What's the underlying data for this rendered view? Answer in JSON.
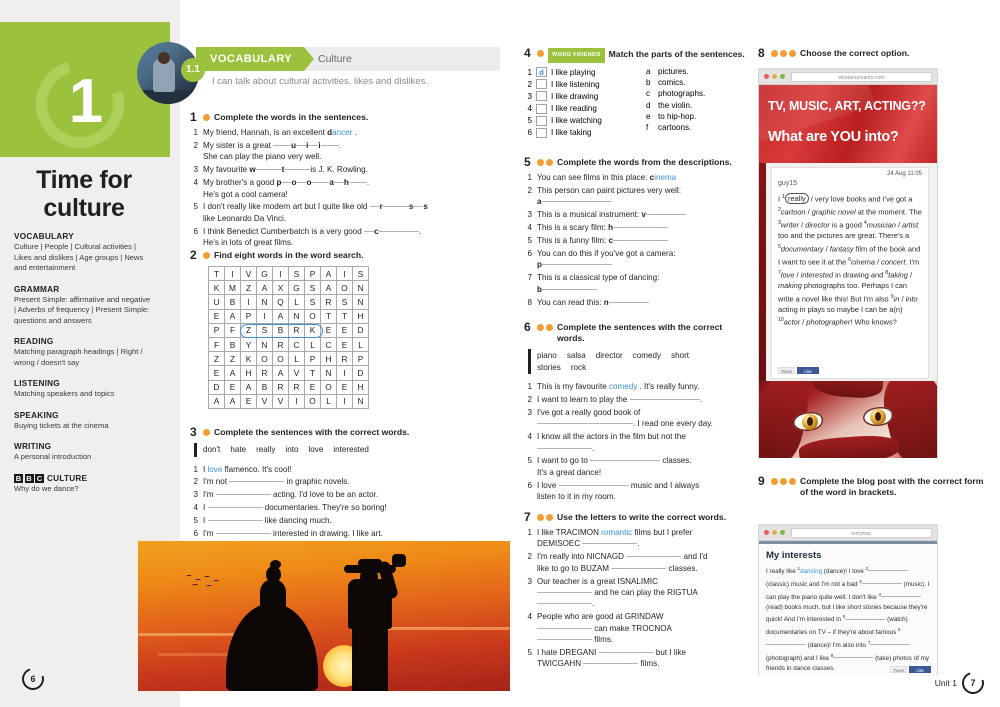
{
  "unit": {
    "number": "1",
    "title": "Time for\nculture",
    "lesson_badge": "1.1"
  },
  "header": {
    "section_label": "VOCABULARY",
    "topic": "Culture",
    "can_do": "I can talk about cultural activities, likes and dislikes."
  },
  "syllabus": [
    {
      "title": "VOCABULARY",
      "body": "Culture | People | Cultural activities | Likes and dislikes | Age groups | News and entertainment"
    },
    {
      "title": "GRAMMAR",
      "body": "Present Simple: affirmative and negative | Adverbs of frequency | Present Simple: questions and answers"
    },
    {
      "title": "READING",
      "body": "Matching paragraph headings | Right / wrong / doesn't say"
    },
    {
      "title": "LISTENING",
      "body": "Matching speakers and topics"
    },
    {
      "title": "SPEAKING",
      "body": "Buying tickets at the cinema"
    },
    {
      "title": "WRITING",
      "body": "A personal introduction"
    }
  ],
  "bbc": {
    "letters": "BBC",
    "word": "CULTURE",
    "body": "Why do we dance?"
  },
  "ex1": {
    "number": "1",
    "dots": 1,
    "title": "Complete the words in the sentences.",
    "items": [
      {
        "n": "1",
        "pre": "My friend, Hannah, is an excellent ",
        "bold": "d",
        "answer": "ancer",
        "post": "."
      },
      {
        "n": "2",
        "pre": "My sister is a great ",
        "bold": "",
        "answer": "",
        "post": " u i i . She can play the piano very well."
      },
      {
        "n": "3",
        "pre": "My favourite ",
        "bold": "w",
        "answer": "",
        "post": " t is J. K. Rowling."
      },
      {
        "n": "4",
        "pre": "My brother's a good ",
        "bold": "p",
        "answer": "",
        "post": " o o a h . He's got a cool camera!"
      },
      {
        "n": "5",
        "pre": "I don't really like modern art but I quite like old ",
        "bold": "",
        "answer": "",
        "post": " r s s like Leonardo Da Vinci."
      },
      {
        "n": "6",
        "pre": "I think Benedict Cumberbatch is a very good ",
        "bold": "",
        "answer": "",
        "post": " c . He's in lots of great films."
      }
    ]
  },
  "ex2": {
    "number": "2",
    "dots": 1,
    "title": "Find eight words in the word search.",
    "grid": [
      [
        "T",
        "I",
        "V",
        "G",
        "I",
        "S",
        "P",
        "A",
        "I",
        "S"
      ],
      [
        "K",
        "M",
        "Z",
        "A",
        "X",
        "G",
        "S",
        "A",
        "O",
        "N"
      ],
      [
        "U",
        "B",
        "I",
        "N",
        "Q",
        "L",
        "S",
        "R",
        "S",
        "N"
      ],
      [
        "E",
        "A",
        "P",
        "I",
        "A",
        "N",
        "O",
        "T",
        "T",
        "H"
      ],
      [
        "P",
        "F",
        "Z",
        "S",
        "B",
        "R",
        "K",
        "E",
        "E",
        "D"
      ],
      [
        "F",
        "B",
        "Y",
        "N",
        "R",
        "C",
        "L",
        "C",
        "E",
        "L"
      ],
      [
        "Z",
        "Z",
        "K",
        "O",
        "O",
        "L",
        "P",
        "H",
        "R",
        "P"
      ],
      [
        "E",
        "A",
        "H",
        "R",
        "A",
        "V",
        "T",
        "N",
        "I",
        "D"
      ],
      [
        "D",
        "E",
        "A",
        "B",
        "R",
        "R",
        "E",
        "O",
        "E",
        "H"
      ],
      [
        "A",
        "A",
        "E",
        "V",
        "V",
        "I",
        "O",
        "L",
        "I",
        "N"
      ]
    ],
    "highlighted_word": "PIANO"
  },
  "ex3": {
    "number": "3",
    "dots": 1,
    "title": "Complete the sentences with the correct words.",
    "wordbank": [
      "don't",
      "hate",
      "really",
      "into",
      "love",
      "interested"
    ],
    "items": [
      {
        "n": "1",
        "pre": "I ",
        "answer": "love",
        "post": " flamenco. It's cool!"
      },
      {
        "n": "2",
        "pre": "I'm not ",
        "answer": "",
        "post": " in graphic novels."
      },
      {
        "n": "3",
        "pre": "I'm ",
        "answer": "",
        "post": " acting. I'd love to be an actor."
      },
      {
        "n": "4",
        "pre": "I ",
        "answer": "",
        "post": " documentaries. They're so boring!"
      },
      {
        "n": "5",
        "pre": "I ",
        "answer": "",
        "post": " like dancing much."
      },
      {
        "n": "6",
        "pre": "I'm ",
        "answer": "",
        "post": " interested in drawing. I like art."
      }
    ]
  },
  "ex4": {
    "number": "4",
    "dots": 1,
    "tag": "WORD FRIENDS",
    "title": "Match the parts of the sentences.",
    "left": [
      {
        "n": "1",
        "box": "d",
        "text": "I like playing"
      },
      {
        "n": "2",
        "box": "",
        "text": "I like listening"
      },
      {
        "n": "3",
        "box": "",
        "text": "I like drawing"
      },
      {
        "n": "4",
        "box": "",
        "text": "I like reading"
      },
      {
        "n": "5",
        "box": "",
        "text": "I like watching"
      },
      {
        "n": "6",
        "box": "",
        "text": "I like taking"
      }
    ],
    "right": [
      {
        "l": "a",
        "text": "pictures."
      },
      {
        "l": "b",
        "text": "comics."
      },
      {
        "l": "c",
        "text": "photographs."
      },
      {
        "l": "d",
        "text": "the violin."
      },
      {
        "l": "e",
        "text": "to hip-hop."
      },
      {
        "l": "f",
        "text": "cartoons."
      }
    ]
  },
  "ex5": {
    "number": "5",
    "dots": 2,
    "title": "Complete the words from the descriptions.",
    "items": [
      {
        "n": "1",
        "pre": "You can see films in this place: ",
        "bold": "c",
        "answer": "inema",
        "post": ""
      },
      {
        "n": "2",
        "pre": "This person can paint pictures very well: ",
        "bold": "a",
        "answer": "",
        "post": ""
      },
      {
        "n": "3",
        "pre": "This is a musical instrument: ",
        "bold": "v",
        "answer": "",
        "post": ""
      },
      {
        "n": "4",
        "pre": "This is a scary film: ",
        "bold": "h",
        "answer": "",
        "post": ""
      },
      {
        "n": "5",
        "pre": "This is a funny film: ",
        "bold": "c",
        "answer": "",
        "post": ""
      },
      {
        "n": "6",
        "pre": "You can do this if you've got a camera: ",
        "bold": "p",
        "answer": "",
        "post": ""
      },
      {
        "n": "7",
        "pre": "This is a classical type of dancing: ",
        "bold": "b",
        "answer": "",
        "post": ""
      },
      {
        "n": "8",
        "pre": "You can read this: ",
        "bold": "n",
        "answer": "",
        "post": ""
      }
    ]
  },
  "ex6": {
    "number": "6",
    "dots": 2,
    "title": "Complete the sentences with the correct words.",
    "wordbank": [
      "piano",
      "salsa",
      "director",
      "comedy",
      "short stories",
      "rock"
    ],
    "items": [
      {
        "n": "1",
        "pre": "This is my favourite ",
        "answer": "comedy",
        "post": " . It's really funny."
      },
      {
        "n": "2",
        "pre": "I want to learn to play the ",
        "answer": "",
        "post": " ."
      },
      {
        "n": "3",
        "pre": "I've got a really good book of ",
        "answer": "",
        "post": " . I read one every day."
      },
      {
        "n": "4",
        "pre": "I know all the actors in the film but not the ",
        "answer": "",
        "post": " ."
      },
      {
        "n": "5",
        "pre": "I want to go to ",
        "answer": "",
        "post": " classes. It's a great dance!"
      },
      {
        "n": "6",
        "pre": "I love ",
        "answer": "",
        "post": " music and I always listen to it in my room."
      }
    ]
  },
  "ex7": {
    "number": "7",
    "dots": 2,
    "title": "Use the letters to write the correct words.",
    "items": [
      {
        "n": "1",
        "parts": "I like TRACIMON |romantic| films but I prefer DEMISOEC ___ ."
      },
      {
        "n": "2",
        "parts": "I'm really into NICNAGD ___ and I'd like to go to BUZAM ___ classes."
      },
      {
        "n": "3",
        "parts": "Our teacher is a great ISNALIMIC ___ and he can play the RIGTUA ___ ."
      },
      {
        "n": "4",
        "parts": "People who are good at GRINDAW ___ can make TROCNOA ___ films."
      },
      {
        "n": "5",
        "parts": "I hate DREGANI ___ but I like TWICGAHN ___ films."
      }
    ]
  },
  "ex8": {
    "number": "8",
    "dots": 3,
    "title": "Choose the correct option.",
    "browser_url": "whatareyouinto.com",
    "hero_line1": "TV, MUSIC, ART, ACTING??",
    "hero_line2": "What are YOU into?",
    "post_date": "24 Aug 11:05",
    "username": "guy15",
    "post_text": "I 1really / very love books and I've got a 2cartoon / graphic novel at the moment. The 3writer / director is a good 4musician / artist too and the pictures are great. There's a 5documentary / fantasy film of the book and I want to see it at the 6cinema / concert. I'm 7love / interested in drawing and 8taking / making photographs too. Perhaps I can write a novel like this! But I'm also 9in / into acting in plays so maybe I can be a(n) 10actor / photographer! Who knows?",
    "circled_option": "really",
    "social": [
      "Tweet",
      "Like"
    ]
  },
  "ex9": {
    "number": "9",
    "dots": 3,
    "title": "Complete the blog post with the correct form of the word in brackets.",
    "browser_url": "terrymac",
    "blog_title": "My interests",
    "blog_text": "I really like 1dancing (dance)! I love 2_____ (classic) music and I'm not a bad 3_____ (music). I can play the piano quite well. I don't like 4_____ (read) books much, but I like short stories because they're quick! And I'm interested in 5_____ (watch) documentaries on TV – if they're about famous 6_____ (dance)! I'm also into 7_____ (photograph) and I like 8_____ (take) photos of my friends in dance classes.",
    "answer1": "dancing",
    "social": [
      "Tweet",
      "Like"
    ]
  },
  "footer": {
    "left_page": "6",
    "unit_label": "Unit 1",
    "right_page": "7"
  },
  "colors": {
    "green": "#9cc23d",
    "orange": "#f29c33",
    "blue_answer": "#3b8fd4",
    "grey_panel": "#f0efed"
  }
}
